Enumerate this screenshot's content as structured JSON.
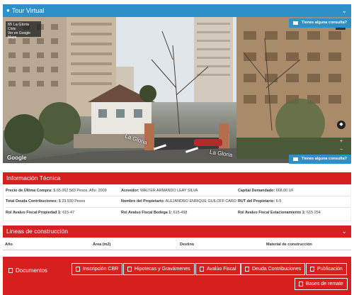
{
  "tour": {
    "title": "Tour Virtual"
  },
  "streetview": {
    "place": "65 La Gloria",
    "sub1": "Chile",
    "sub2": "Ver en Google Maps",
    "google": "Google",
    "copyright": "© 2018 Google   Condiciones",
    "road1": "La Gloria",
    "road2": "La Gloria"
  },
  "consult": {
    "label": "Tienes alguna consulta?"
  },
  "tecnica": {
    "title": "Información Técnica",
    "rows": [
      [
        {
          "label": "Precio de Última Compra:",
          "value": "$ 65.062.583 Pesos, Año: 2009"
        },
        {
          "label": "Acreedor:",
          "value": "WALTER ARMANDO LEAY SILVA"
        },
        {
          "label": "Capital Demandado:",
          "value": "668,00 UF"
        }
      ],
      [
        {
          "label": "Total Deuda Contribuciones:",
          "value": "$ 23.930 Pesos"
        },
        {
          "label": "Nombre del Propietario:",
          "value": "ALEJANDRO ENRIQUE GUILOFF CARO"
        },
        {
          "label": "RUT del Propietario:",
          "value": "6-5"
        }
      ],
      [
        {
          "label": "Rol Avaluo Fiscal Propiedad 1:",
          "value": "615-47"
        },
        {
          "label": "Rol Avaluo Fiscal Bodega 1:",
          "value": "615-498"
        },
        {
          "label": "Rol Avaluo Fiscal Estacionamiento 1:",
          "value": "615-254"
        }
      ]
    ]
  },
  "lineas": {
    "title": "Lineas de construcción",
    "columns": [
      "Año",
      "Área (m2)",
      "Destino",
      "Material de construcción"
    ]
  },
  "documentos": {
    "title": "Documentos",
    "buttons": [
      "Inscripción CBR",
      "Hipotecas y Gravámenes",
      "Avalúo Fiscal",
      "Deuda Contribuciones",
      "Publicación",
      "Bases de remate"
    ]
  }
}
